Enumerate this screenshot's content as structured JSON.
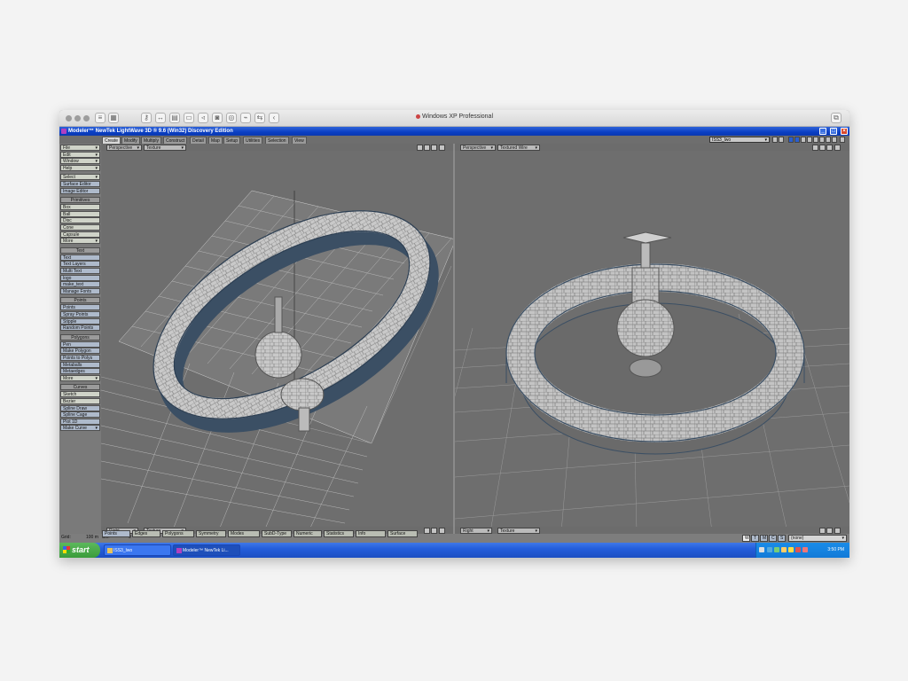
{
  "host": {
    "title": "Windows XP Professional"
  },
  "window": {
    "title": "Modeler™ NewTek LightWave 3D ® 9.6  (Win32) Discovery Edition"
  },
  "menu": {
    "tabs": [
      "Create",
      "Modify",
      "Multiply",
      "Construct",
      "Detail",
      "Map",
      "Setup",
      "Utilities",
      "Selection",
      "View"
    ],
    "object": "ISS3_lwo"
  },
  "sidebar": {
    "top": [
      "File",
      "Edit",
      "Window",
      "Help",
      "Select",
      "Surface Editor",
      "Image Editor"
    ],
    "primitives_header": "Primitives",
    "primitives": [
      "Box",
      "Ball",
      "Disc",
      "Cone",
      "Capsule",
      "More"
    ],
    "text_header": "Text",
    "text": [
      "Text",
      "Text Layers",
      "Multi Text",
      "logo",
      "make_text",
      "Manage Fonts"
    ],
    "points_header": "Points",
    "points": [
      "Points",
      "Spray Points",
      "Stipple",
      "Random Points"
    ],
    "polygons_header": "Polygons",
    "polygons": [
      "Pen",
      "Make Polygon",
      "Points to Polys",
      "Metaballs",
      "Metaedges",
      "More"
    ],
    "curves_header": "Curves",
    "curves": [
      "Sketch",
      "Bezier",
      "Spline Draw",
      "Spline Cage",
      "Plot 1D",
      "Make Curve"
    ]
  },
  "viewports": {
    "left_view": "Perspective",
    "left_mode": "Texture",
    "right_view": "Perspective",
    "right_mode": "Textured Wire",
    "bottom_left_view": "Right",
    "bottom_left_mode": "Texture",
    "bottom_right_view": "Right",
    "bottom_right_mode": "Texture"
  },
  "status": {
    "sel_label": "Sel:",
    "sel_value": "0",
    "grid_label": "Grid:",
    "grid_value": "100 m",
    "buttons": [
      "Points",
      "Edges",
      "Polygons",
      "Symmetry",
      "Modes",
      "SubD-Type",
      "Numeric",
      "Statistics",
      "Info",
      "Surface"
    ],
    "layers": [
      "W",
      "T",
      "M",
      "C",
      "S"
    ],
    "layer_select": "(none)"
  },
  "taskbar": {
    "start": "start",
    "tasks": [
      "ISS3_lwo",
      "Modeler™ NewTek Li..."
    ],
    "clock": "3:50 PM"
  },
  "colors": {
    "xp_blue": "#0a3fc4",
    "start_green": "#3a9c3a",
    "viewport_gray": "#6e6e6e"
  }
}
